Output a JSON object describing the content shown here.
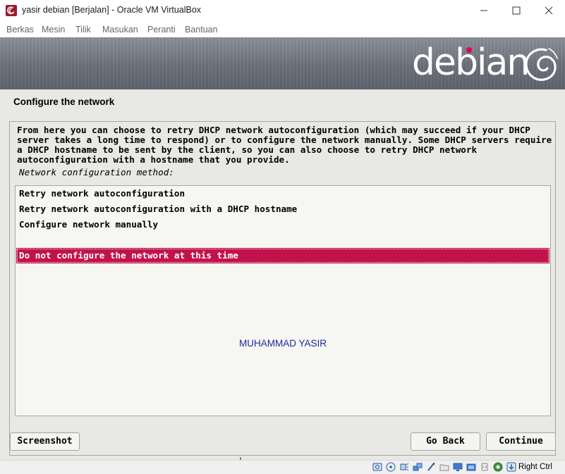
{
  "window": {
    "title": "yasir debian [Berjalan] - Oracle VM VirtualBox",
    "menu": [
      "Berkas",
      "Mesin",
      "Tilik",
      "Masukan",
      "Peranti",
      "Bantuan"
    ]
  },
  "installer": {
    "brand": "debian",
    "section_title": "Configure the network",
    "description": "From here you can choose to retry DHCP network autoconfiguration (which may succeed if your DHCP server takes a long time to respond) or to configure the network manually. Some DHCP servers require a DHCP hostname to be sent by the client, so you can also choose to retry DHCP network autoconfiguration with a hostname that you provide.",
    "method_label": "Network configuration method:",
    "options": [
      "Retry network autoconfiguration",
      "Retry network autoconfiguration with a DHCP hostname",
      "Configure network manually",
      "Do not configure the network at this time"
    ],
    "selected_option": "Do not configure the network at this time",
    "watermark": "MUHAMMAD YASIR",
    "buttons": {
      "screenshot": "Screenshot",
      "go_back": "Go Back",
      "continue": "Continue"
    },
    "accent_color": "#c2124e",
    "watermark_color": "#1e2a9e"
  },
  "statusbar": {
    "icons": [
      "hard-disk-icon",
      "optical-disk-icon",
      "audio-icon",
      "network-icon",
      "usb-icon",
      "shared-folder-icon",
      "display-icon",
      "recording-icon",
      "cpu-icon",
      "mouse-integration-icon",
      "keyboard-capture-icon"
    ],
    "host_key": "Right Ctrl"
  }
}
